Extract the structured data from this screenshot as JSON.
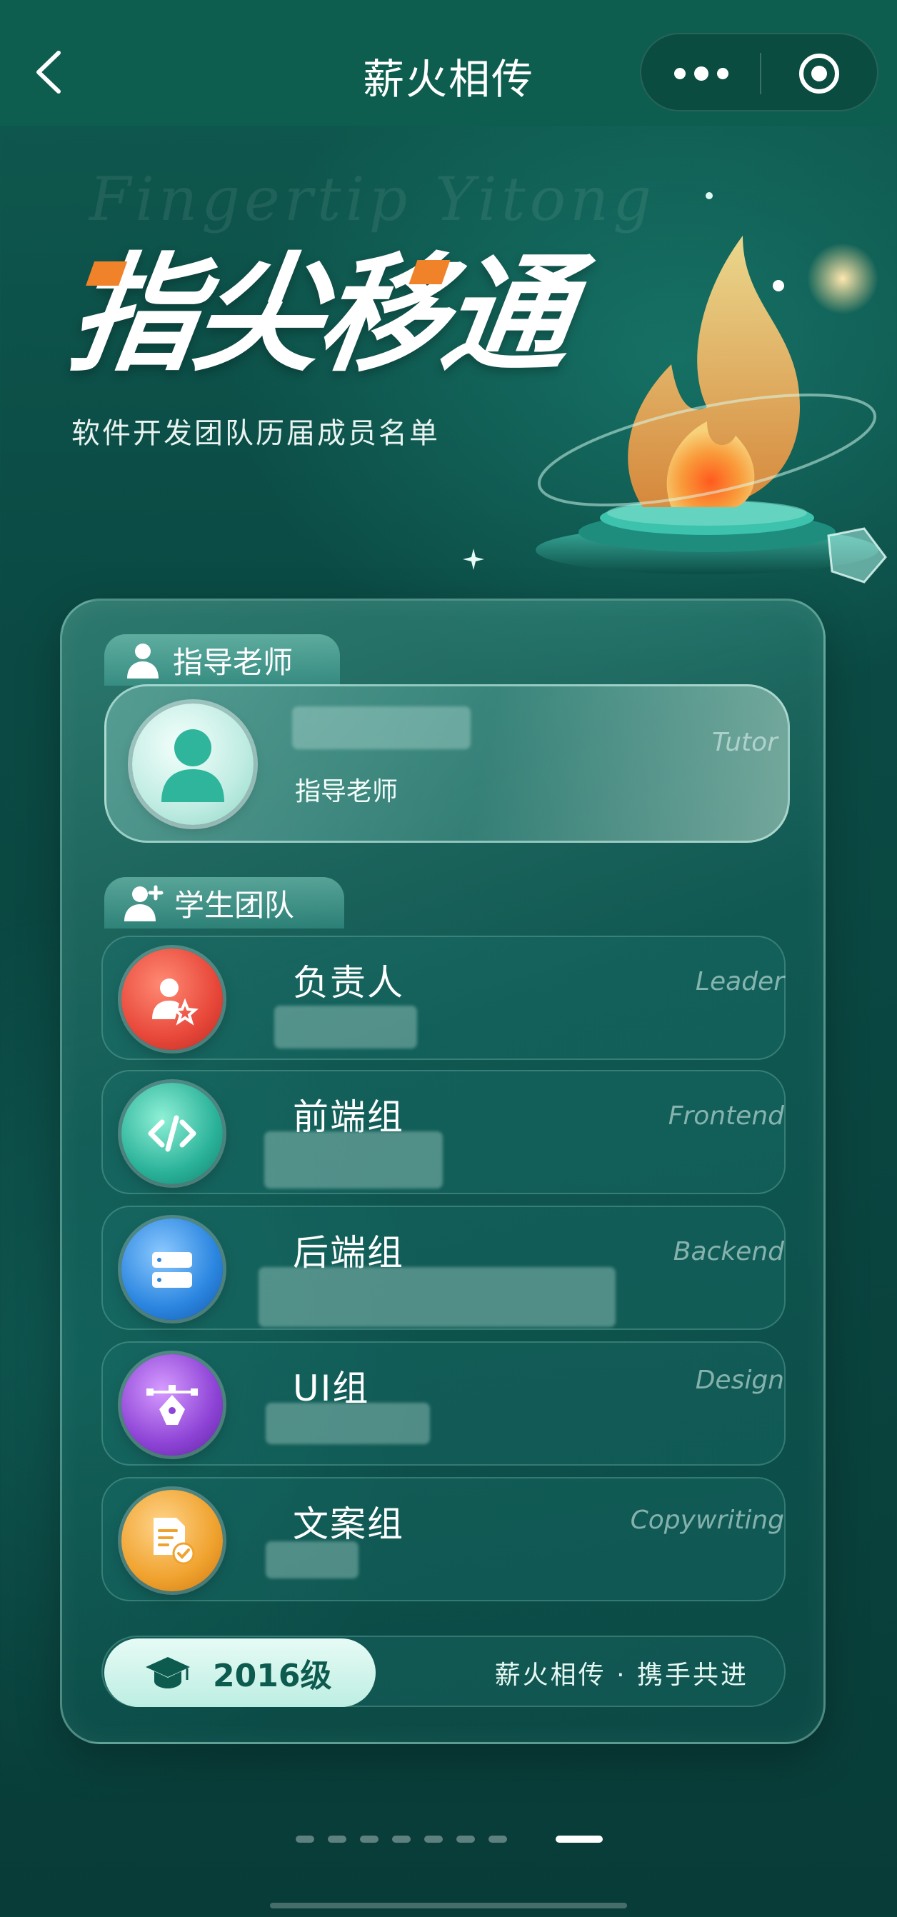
{
  "nav": {
    "title": "薪火相传"
  },
  "hero": {
    "watermark": "Fingertip Yitong",
    "title": "指尖移通",
    "subtitle": "软件开发团队历届成员名单"
  },
  "tutor_section": {
    "label": "指导老师",
    "role": "指导老师",
    "tag": "Tutor"
  },
  "student_section": {
    "label": "学生团队",
    "groups": [
      {
        "name": "负责人",
        "tag": "Leader",
        "color": "#e8483a"
      },
      {
        "name": "前端组",
        "tag": "Frontend",
        "color": "#2bb39a"
      },
      {
        "name": "后端组",
        "tag": "Backend",
        "color": "#2b86e0"
      },
      {
        "name": "UI组",
        "tag": "Design",
        "color": "#8e44d6"
      },
      {
        "name": "文案组",
        "tag": "Copywriting",
        "color": "#f0a22e"
      }
    ]
  },
  "footer": {
    "year": "2016级",
    "motto": "薪火相传 · 携手共进"
  },
  "pager": {
    "count": 8,
    "active_index": 7
  }
}
